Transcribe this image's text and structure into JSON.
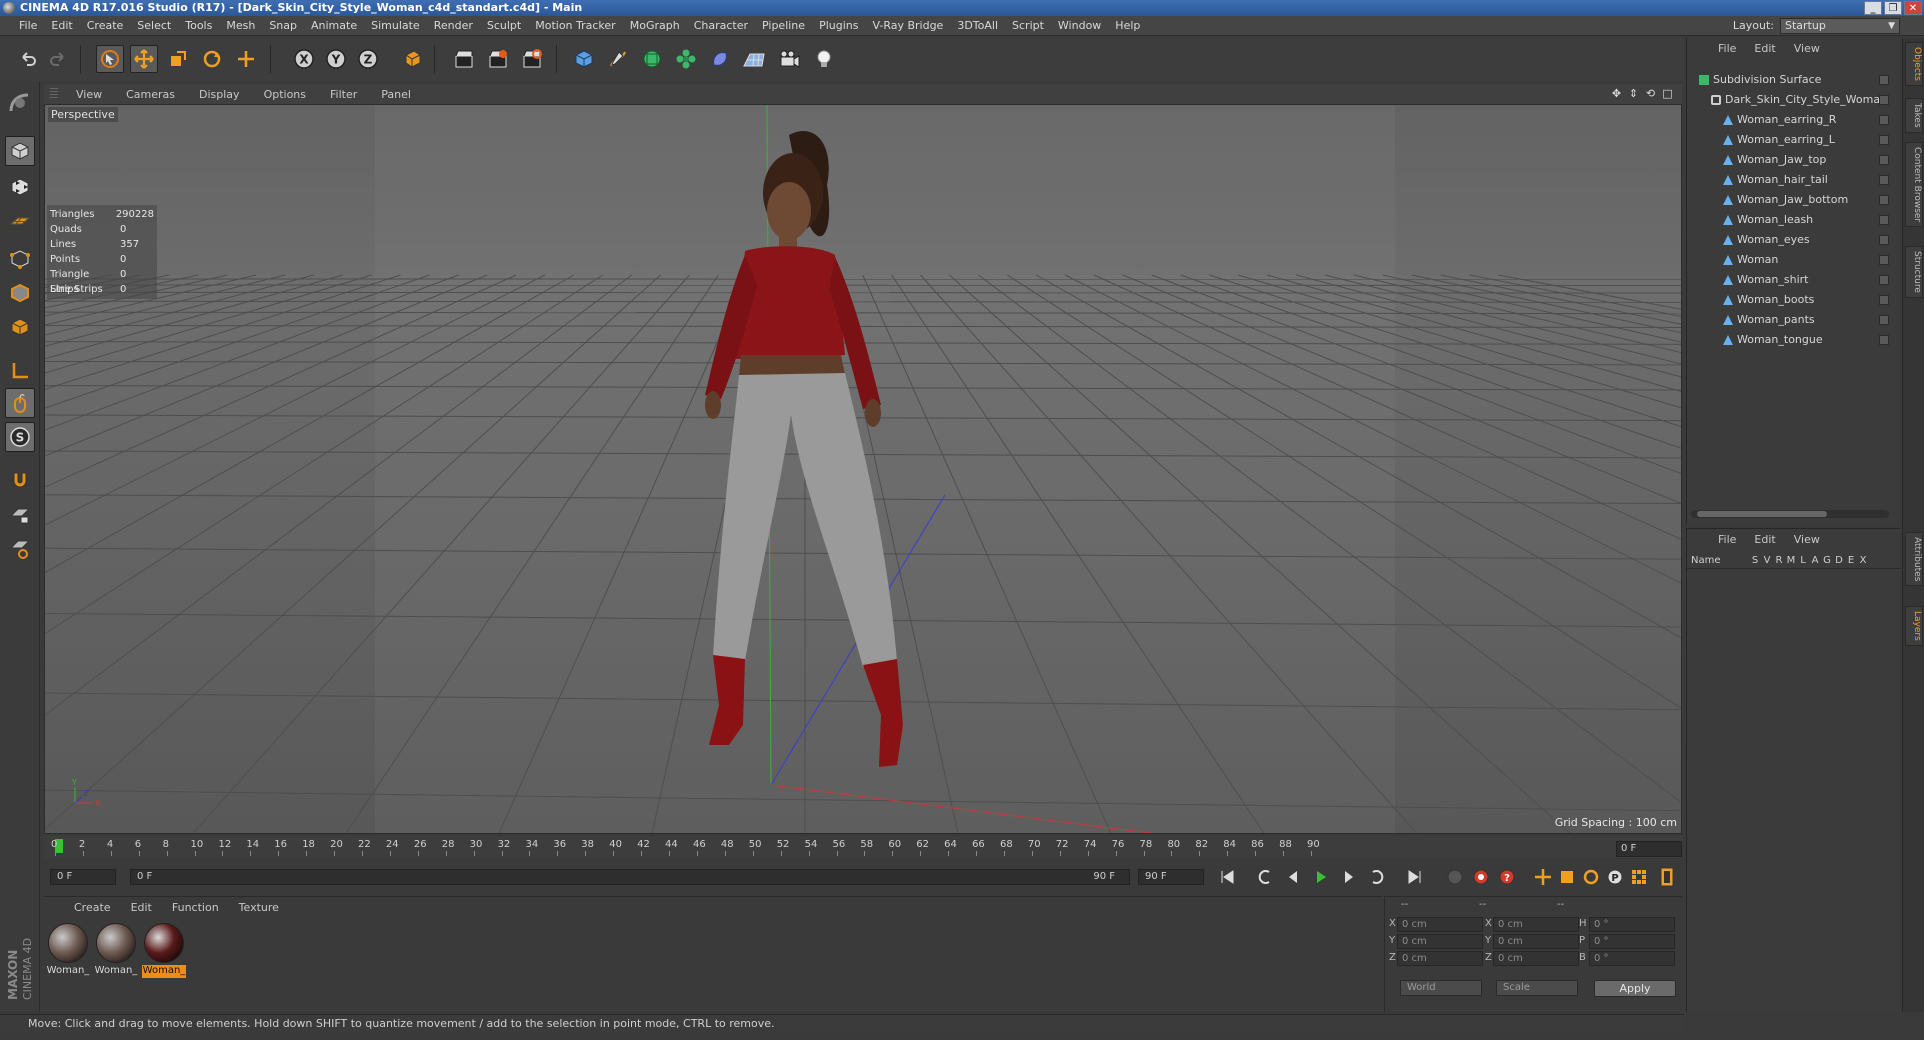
{
  "window": {
    "title": "CINEMA 4D R17.016 Studio (R17) - [Dark_Skin_City_Style_Woman_c4d_standart.c4d] - Main"
  },
  "menubar": {
    "items": [
      "File",
      "Edit",
      "Create",
      "Select",
      "Tools",
      "Mesh",
      "Snap",
      "Animate",
      "Simulate",
      "Render",
      "Sculpt",
      "Motion Tracker",
      "MoGraph",
      "Character",
      "Pipeline",
      "Plugins",
      "V-Ray Bridge",
      "3DToAll",
      "Script",
      "Window",
      "Help"
    ],
    "layout_label": "Layout:",
    "layout_value": "Startup"
  },
  "viewport": {
    "menu": [
      "View",
      "Cameras",
      "Display",
      "Options",
      "Filter",
      "Panel"
    ],
    "view_name": "Perspective",
    "stats": [
      {
        "label": "Triangles",
        "value": "290228"
      },
      {
        "label": "Quads",
        "value": "0"
      },
      {
        "label": "Lines",
        "value": "357"
      },
      {
        "label": "Points",
        "value": "0"
      },
      {
        "label": "Triangle Strips",
        "value": "0"
      },
      {
        "label": "Line Strips",
        "value": "0"
      }
    ],
    "grid_spacing": "Grid Spacing : 100 cm",
    "axis_labels": {
      "y": "Y",
      "x": "X",
      "z": "Z"
    }
  },
  "timeline": {
    "ticks": [
      "0",
      "2",
      "4",
      "6",
      "8",
      "10",
      "12",
      "14",
      "16",
      "18",
      "20",
      "22",
      "24",
      "26",
      "28",
      "30",
      "32",
      "34",
      "36",
      "38",
      "40",
      "42",
      "44",
      "46",
      "48",
      "50",
      "52",
      "54",
      "56",
      "58",
      "60",
      "62",
      "64",
      "66",
      "68",
      "70",
      "72",
      "74",
      "76",
      "78",
      "80",
      "82",
      "84",
      "86",
      "88",
      "90"
    ],
    "current_frame": "0 F"
  },
  "transport": {
    "start_field": "0 F",
    "range_start": "0 F",
    "range_end": "90 F",
    "end_field": "90 F"
  },
  "materials": {
    "menu": [
      "Create",
      "Edit",
      "Function",
      "Texture"
    ],
    "items": [
      {
        "name": "Woman_",
        "selected": false
      },
      {
        "name": "Woman_",
        "selected": false
      },
      {
        "name": "Woman_",
        "selected": true
      }
    ],
    "brand_top": "MAXON",
    "brand_bottom": "CINEMA 4D"
  },
  "coordinates": {
    "header": [
      "--",
      "--",
      "--"
    ],
    "rows": [
      {
        "axis1": "X",
        "pos": "0 cm",
        "axis2": "X",
        "size": "0 cm",
        "axis3": "H",
        "rot": "0 °"
      },
      {
        "axis1": "Y",
        "pos": "0 cm",
        "axis2": "Y",
        "size": "0 cm",
        "axis3": "P",
        "rot": "0 °"
      },
      {
        "axis1": "Z",
        "pos": "0 cm",
        "axis2": "Z",
        "size": "0 cm",
        "axis3": "B",
        "rot": "0 °"
      }
    ],
    "space_select": "World",
    "mode_select": "Scale",
    "apply_label": "Apply"
  },
  "status": "Move: Click and drag to move elements. Hold down SHIFT to quantize movement / add to the selection in point mode, CTRL to remove.",
  "object_manager": {
    "menu": [
      "File",
      "Edit",
      "View"
    ],
    "objects": [
      {
        "name": "Subdivision Surface",
        "level": 0,
        "type": "subdiv"
      },
      {
        "name": "Dark_Skin_City_Style_Woman",
        "level": 1,
        "type": "null"
      },
      {
        "name": "Woman_earring_R",
        "level": 2,
        "type": "joint"
      },
      {
        "name": "Woman_earring_L",
        "level": 2,
        "type": "joint"
      },
      {
        "name": "Woman_Jaw_top",
        "level": 2,
        "type": "joint"
      },
      {
        "name": "Woman_hair_tail",
        "level": 2,
        "type": "joint"
      },
      {
        "name": "Woman_Jaw_bottom",
        "level": 2,
        "type": "joint"
      },
      {
        "name": "Woman_leash",
        "level": 2,
        "type": "joint"
      },
      {
        "name": "Woman_eyes",
        "level": 2,
        "type": "joint"
      },
      {
        "name": "Woman",
        "level": 2,
        "type": "joint"
      },
      {
        "name": "Woman_shirt",
        "level": 2,
        "type": "joint"
      },
      {
        "name": "Woman_boots",
        "level": 2,
        "type": "joint"
      },
      {
        "name": "Woman_pants",
        "level": 2,
        "type": "joint"
      },
      {
        "name": "Woman_tongue",
        "level": 2,
        "type": "joint"
      }
    ]
  },
  "layer_manager": {
    "menu": [
      "File",
      "Edit",
      "View"
    ],
    "columns": [
      "Name",
      "S",
      "V",
      "R",
      "M",
      "L",
      "A",
      "G",
      "D",
      "E",
      "X"
    ]
  },
  "side_tabs": {
    "top": [
      "Objects",
      "Takes",
      "Content Browser",
      "Structure"
    ],
    "bottom": [
      "Attributes",
      "Layers"
    ]
  },
  "colors": {
    "accent": "#f08c1a",
    "title_bar": "#2a5796",
    "panel_bg": "#3b3b3b",
    "viewport_bg": "#5f5f5f",
    "play_green": "#35c335",
    "record_red": "#d23a2a"
  }
}
